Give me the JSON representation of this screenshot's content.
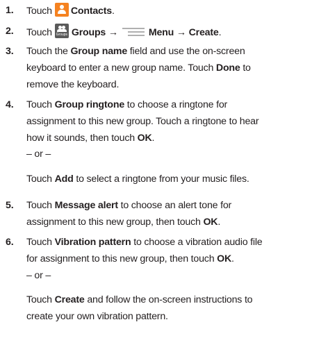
{
  "steps": [
    {
      "num": "1.",
      "touch": "Touch",
      "contacts": "Contacts",
      "period": "."
    },
    {
      "num": "2.",
      "touch": "Touch",
      "groups": "Groups",
      "arrow1": "→",
      "menu": "Menu",
      "arrow2": "→",
      "create": "Create",
      "period": "."
    },
    {
      "num": "3.",
      "l1_a": "Touch the ",
      "l1_b": "Group name",
      "l1_c": " field and use the on-screen",
      "l2_a": "keyboard to enter a new group name. Touch ",
      "l2_b": "Done",
      "l2_c": " to",
      "l3": "remove the keyboard."
    },
    {
      "num": "4.",
      "l1_a": "Touch ",
      "l1_b": "Group ringtone",
      "l1_c": " to choose a ringtone for",
      "l2": "assignment to this new group. Touch a ringtone to hear",
      "l3_a": "how it sounds, then touch ",
      "l3_b": "OK",
      "l3_c": ".",
      "or": "– or –",
      "alt_a": "Touch ",
      "alt_b": "Add",
      "alt_c": " to select a ringtone from your music files."
    },
    {
      "num": "5.",
      "l1_a": "Touch ",
      "l1_b": "Message alert",
      "l1_c": " to choose an alert tone for",
      "l2_a": "assignment to this new group, then touch ",
      "l2_b": "OK",
      "l2_c": "."
    },
    {
      "num": "6.",
      "l1_a": "Touch ",
      "l1_b": "Vibration pattern",
      "l1_c": " to choose a vibration audio file",
      "l2_a": "for assignment to this new group, then touch ",
      "l2_b": "OK",
      "l2_c": ".",
      "or": "– or –",
      "alt1_a": "Touch ",
      "alt1_b": "Create",
      "alt1_c": " and follow the on-screen instructions to",
      "alt2": "create your own vibration pattern."
    }
  ],
  "icons": {
    "contacts_icon": "contacts-icon",
    "groups_icon": "groups-icon",
    "groups_icon_caption": "Groups",
    "menu_icon": "menu-icon",
    "contacts_color": "#f58220",
    "groups_color": "#5a5a5a"
  }
}
